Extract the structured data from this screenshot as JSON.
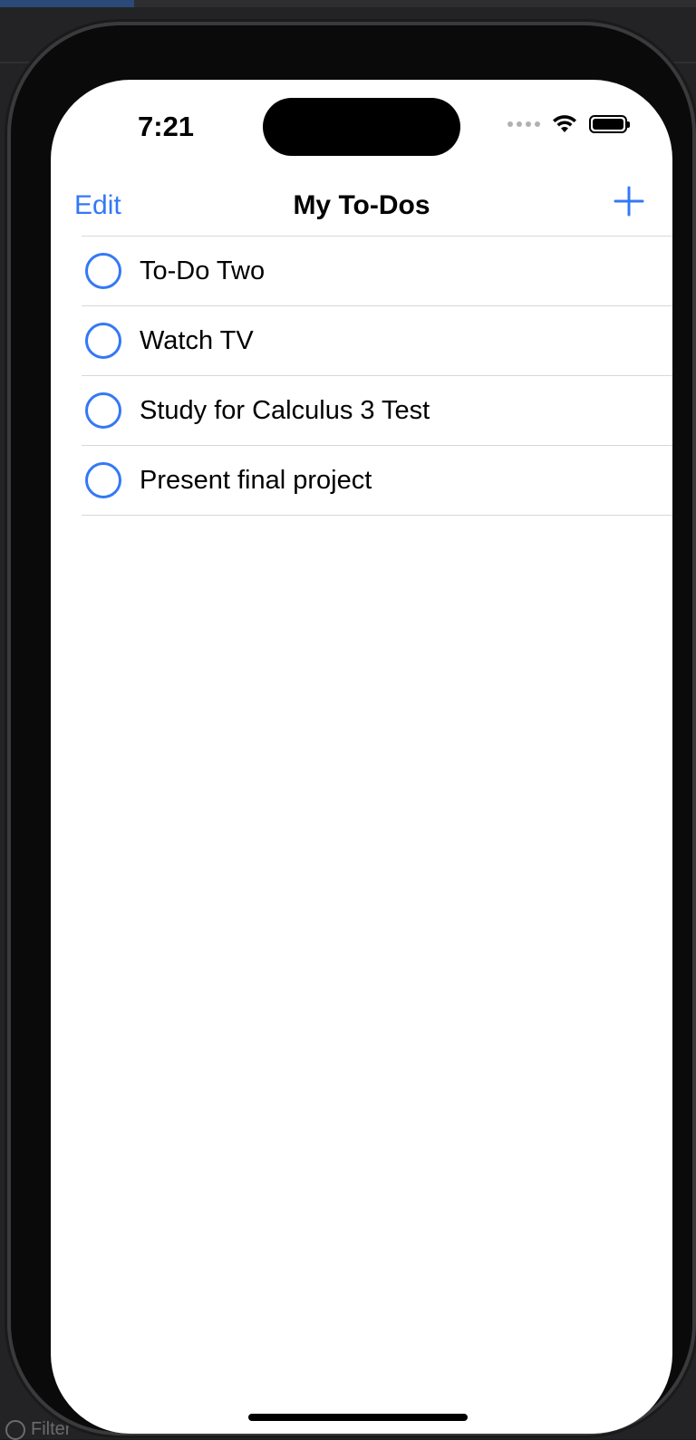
{
  "status_bar": {
    "time": "7:21"
  },
  "nav": {
    "edit_label": "Edit",
    "title": "My To-Dos",
    "add_icon": "plus-icon"
  },
  "todos": [
    {
      "title": "To-Do Two",
      "completed": false
    },
    {
      "title": "Watch TV",
      "completed": false
    },
    {
      "title": "Study for Calculus 3 Test",
      "completed": false
    },
    {
      "title": "Present final project",
      "completed": false
    }
  ],
  "ide": {
    "filter_placeholder": "Filter"
  },
  "colors": {
    "accent": "#3478f6",
    "separator": "#d8d8dc",
    "background": "#ffffff"
  }
}
